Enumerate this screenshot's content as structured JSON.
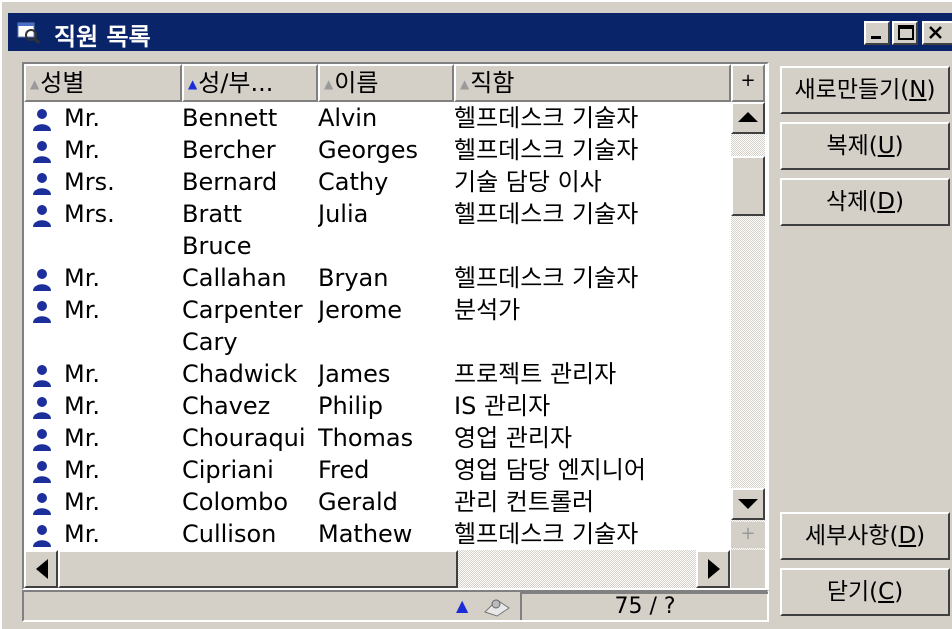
{
  "window": {
    "title": "직원 목록"
  },
  "columns": [
    {
      "label": "성별",
      "sorted": false
    },
    {
      "label": "성/부...",
      "sorted": true
    },
    {
      "label": "이름",
      "sorted": false
    },
    {
      "label": "직함",
      "sorted": false
    }
  ],
  "add_column_label": "+",
  "rows": [
    {
      "title": "Mr.",
      "last": "Bennett",
      "first": "Alvin",
      "job": "헬프데스크 기술자",
      "icon": "person-icon"
    },
    {
      "title": "Mr.",
      "last": "Bercher",
      "first": "Georges",
      "job": "헬프데스크 기술자",
      "icon": "person-icon"
    },
    {
      "title": "Mrs.",
      "last": "Bernard",
      "first": "Cathy",
      "job": "기술 담당 이사",
      "icon": "person-icon"
    },
    {
      "title": "Mrs.",
      "last": "Bratt",
      "first": "Julia",
      "job": "헬프데스크 기술자",
      "icon": "person-icon"
    },
    {
      "title": "",
      "last": "Bruce",
      "first": "",
      "job": "",
      "icon": ""
    },
    {
      "title": "Mr.",
      "last": "Callahan",
      "first": "Bryan",
      "job": "헬프데스크 기술자",
      "icon": "person-icon"
    },
    {
      "title": "Mr.",
      "last": "Carpenter",
      "first": "Jerome",
      "job": "분석가",
      "icon": "person-icon"
    },
    {
      "title": "",
      "last": "Cary",
      "first": "",
      "job": "",
      "icon": ""
    },
    {
      "title": "Mr.",
      "last": "Chadwick",
      "first": "James",
      "job": "프로젝트 관리자",
      "icon": "person-icon"
    },
    {
      "title": "Mr.",
      "last": "Chavez",
      "first": "Philip",
      "job": "IS 관리자",
      "icon": "person-icon"
    },
    {
      "title": "Mr.",
      "last": "Chouraqui",
      "first": "Thomas",
      "job": "영업 관리자",
      "icon": "person-icon"
    },
    {
      "title": "Mr.",
      "last": "Cipriani",
      "first": "Fred",
      "job": "영업 담당 엔지니어",
      "icon": "person-icon"
    },
    {
      "title": "Mr.",
      "last": "Colombo",
      "first": "Gerald",
      "job": "관리 컨트롤러",
      "icon": "person-icon"
    },
    {
      "title": "Mr.",
      "last": "Cullison",
      "first": "Mathew",
      "job": "헬프데스크 기술자",
      "icon": "person-icon"
    }
  ],
  "status": {
    "count": "75 / ?"
  },
  "buttons": {
    "new": {
      "label": "새로만들기(",
      "mnemonic": "N",
      "tail": ")"
    },
    "copy": {
      "label": "복제(",
      "mnemonic": "U",
      "tail": ")"
    },
    "delete": {
      "label": "삭제(",
      "mnemonic": "D",
      "tail": ")"
    },
    "detail": {
      "label": "세부사항(",
      "mnemonic": "D",
      "tail": ")"
    },
    "close": {
      "label": "닫기(",
      "mnemonic": "C",
      "tail": ")"
    }
  },
  "colors": {
    "titlebar": "#0a246a",
    "face": "#d4d0c8",
    "sort_arrow": "#1a2bd8",
    "person_icon": "#1c2f9c"
  }
}
